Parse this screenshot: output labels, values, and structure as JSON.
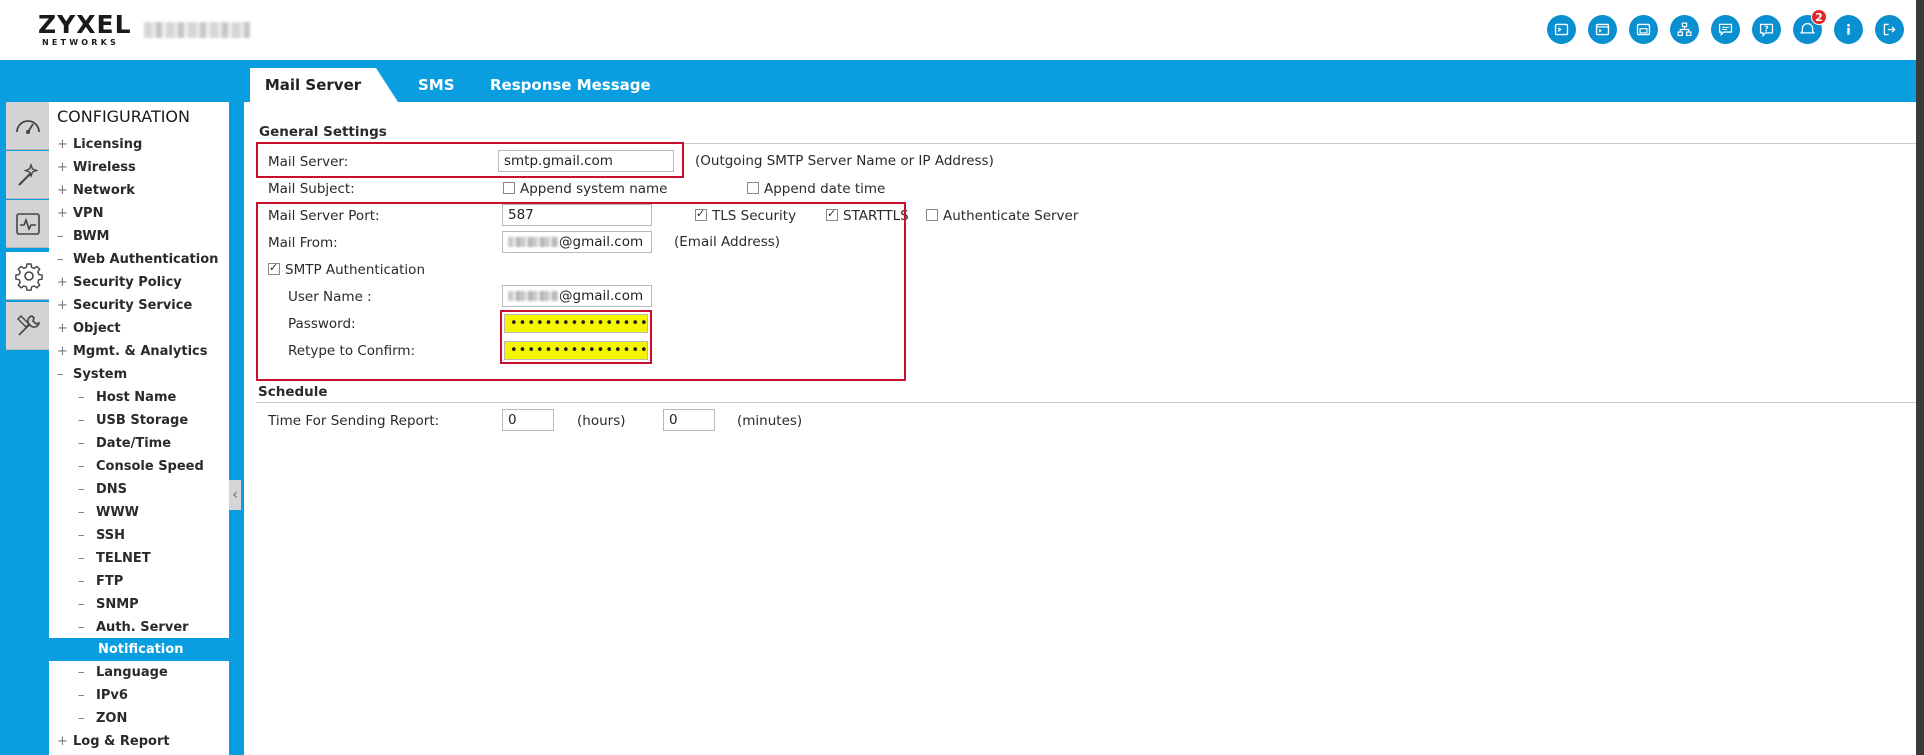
{
  "header": {
    "logo": "ZYXEL",
    "logo_sub": "NETWORKS",
    "notification_count": "2",
    "icons": [
      "console-icon",
      "cli-icon",
      "window-icon",
      "sitemap-icon",
      "messages-icon",
      "help-icon",
      "alerts-icon",
      "info-icon",
      "logout-icon"
    ]
  },
  "tabs": {
    "mail_server": "Mail Server",
    "sms": "SMS",
    "response_message": "Response Message"
  },
  "sidebar": {
    "title": "CONFIGURATION",
    "items": [
      {
        "label": "Licensing",
        "sign": "+"
      },
      {
        "label": "Wireless",
        "sign": "+"
      },
      {
        "label": "Network",
        "sign": "+"
      },
      {
        "label": "VPN",
        "sign": "+"
      },
      {
        "label": "BWM",
        "sign": "–"
      },
      {
        "label": "Web Authentication",
        "sign": "–"
      },
      {
        "label": "Security Policy",
        "sign": "+"
      },
      {
        "label": "Security Service",
        "sign": "+"
      },
      {
        "label": "Object",
        "sign": "+"
      },
      {
        "label": "Mgmt. & Analytics",
        "sign": "+"
      },
      {
        "label": "System",
        "sign": "–"
      }
    ],
    "system_children": [
      "Host Name",
      "USB Storage",
      "Date/Time",
      "Console Speed",
      "DNS",
      "WWW",
      "SSH",
      "TELNET",
      "FTP",
      "SNMP",
      "Auth. Server",
      "Notification",
      "Language",
      "IPv6",
      "ZON"
    ],
    "last_item": {
      "label": "Log & Report",
      "sign": "+"
    },
    "selected": "Notification",
    "dash": "–"
  },
  "general": {
    "title": "General Settings",
    "mail_server_label": "Mail Server:",
    "mail_server_value": "smtp.gmail.com",
    "mail_server_hint": "(Outgoing SMTP Server Name or IP Address)",
    "mail_subject_label": "Mail Subject:",
    "append_system_name": "Append system name",
    "append_date_time": "Append date time",
    "port_label": "Mail Server Port:",
    "port_value": "587",
    "tls_security": "TLS Security",
    "starttls": "STARTTLS",
    "authenticate_server": "Authenticate Server",
    "mail_from_label": "Mail From:",
    "mail_from_value": "@gmail.com",
    "mail_from_hint": "(Email Address)",
    "smtp_auth": "SMTP Authentication",
    "username_label": "User Name :",
    "username_value": "@gmail.com",
    "password_label": "Password:",
    "password_value": "••••••••••••••••",
    "retype_label": "Retype to Confirm:",
    "retype_value": "••••••••••••••••"
  },
  "schedule": {
    "title": "Schedule",
    "time_label": "Time For Sending Report:",
    "hours_value": "0",
    "hours_unit": "(hours)",
    "minutes_value": "0",
    "minutes_unit": "(minutes)"
  },
  "checkbox_state": {
    "append_system_name": false,
    "append_date_time": false,
    "tls_security": true,
    "starttls": true,
    "authenticate_server": false,
    "smtp_auth": true
  },
  "colors": {
    "accent": "#0a9ee0",
    "highlight_box": "#c8102e",
    "password_fill": "#f5f500"
  }
}
